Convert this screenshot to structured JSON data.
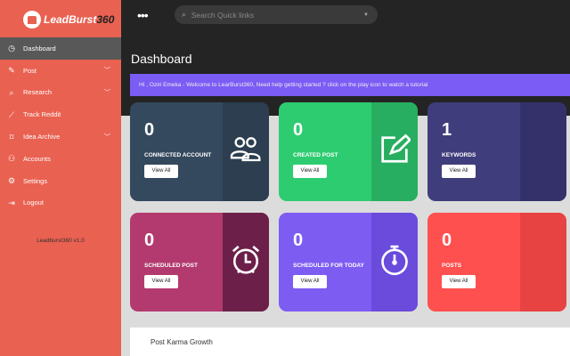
{
  "sidebar": {
    "logo_text": "LeadBurst",
    "logo_suffix": "360",
    "items": [
      {
        "label": "Dashboard",
        "icon": "dashboard-icon"
      },
      {
        "label": "Post",
        "icon": "edit-icon"
      },
      {
        "label": "Research",
        "icon": "search-icon"
      },
      {
        "label": "Track Reddit",
        "icon": "trend-icon"
      },
      {
        "label": "Idea Archive",
        "icon": "bookmark-icon"
      },
      {
        "label": "Accounts",
        "icon": "users-icon"
      },
      {
        "label": "Settings",
        "icon": "gear-icon"
      },
      {
        "label": "Logout",
        "icon": "logout-icon"
      }
    ],
    "version": "Leadburst360 v1.0"
  },
  "header": {
    "search_placeholder": "Search Quick links"
  },
  "page": {
    "title": "Dashboard",
    "banner": "HI , Oziri Emeka - Welcome to LearBurst360, Need help getting started ? click on the play icon to watch a tutorial"
  },
  "cards": [
    {
      "value": "0",
      "label": "CONNECTED ACCOUNT",
      "button": "View All",
      "color": "#34495e",
      "dark": "#2c3e50"
    },
    {
      "value": "0",
      "label": "CREATED POST",
      "button": "View All",
      "color": "#2ecc71",
      "dark": "#27ae60"
    },
    {
      "value": "1",
      "label": "KEYWORDS",
      "button": "View All",
      "color": "#403d7c",
      "dark": "#34316a"
    },
    {
      "value": "0",
      "label": "SCHEDULED POST",
      "button": "View All",
      "color": "#b33a6e",
      "dark": "#6c2049"
    },
    {
      "value": "0",
      "label": "SCHEDULED FOR TODAY",
      "button": "View All",
      "color": "#7d5cf2",
      "dark": "#6a4bdc"
    },
    {
      "value": "0",
      "label": "POSTS",
      "button": "View All",
      "color": "#ff5050",
      "dark": "#e84343"
    }
  ],
  "panel": {
    "title": "Post Karma Growth"
  }
}
